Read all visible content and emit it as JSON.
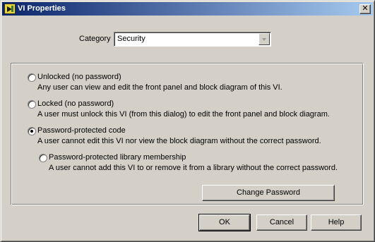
{
  "window": {
    "title": "VI Properties",
    "close_glyph": "✕"
  },
  "category": {
    "label": "Category",
    "value": "Security"
  },
  "options": [
    {
      "label": "Unlocked (no password)",
      "desc": "Any user can view and edit the front panel and block diagram of this VI.",
      "selected": false
    },
    {
      "label": "Locked (no password)",
      "desc": "A user must unlock this VI (from  this dialog) to edit the front panel and block diagram.",
      "selected": false
    },
    {
      "label": "Password-protected code",
      "desc": "A user cannot edit this VI nor view the block diagram without the correct password.",
      "selected": true
    },
    {
      "label": "Password-protected library membership",
      "desc": "A user cannot add this VI to or remove it from a library without the correct password.",
      "selected": false
    }
  ],
  "buttons": {
    "change_password": "Change Password",
    "ok": "OK",
    "cancel": "Cancel",
    "help": "Help"
  },
  "colors": {
    "titlebar_start": "#0a246a",
    "titlebar_end": "#a6caf0",
    "face": "#d4d0c8"
  }
}
